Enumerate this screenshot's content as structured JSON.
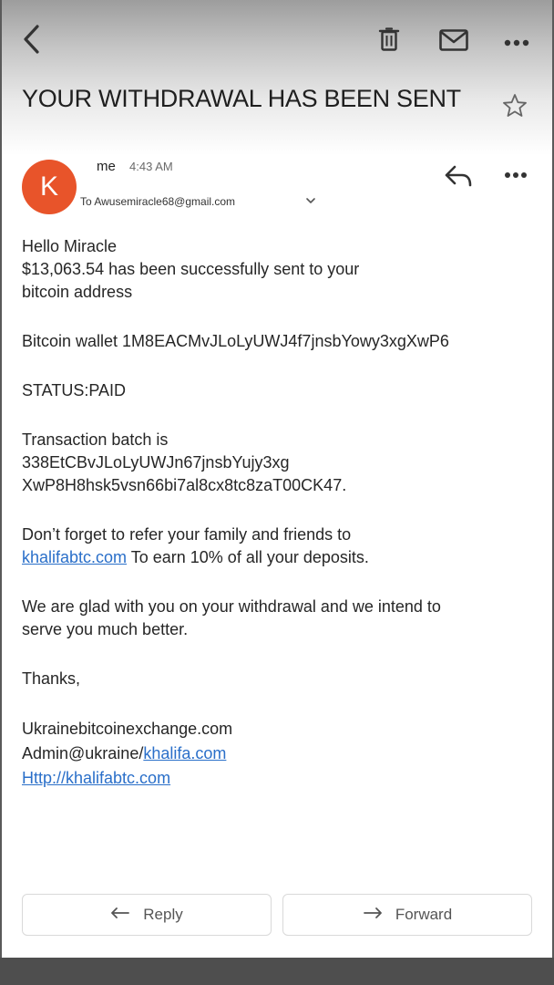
{
  "toolbar": {
    "back_icon": "back-arrow-icon",
    "delete_icon": "trash-icon",
    "mail_icon": "envelope-icon",
    "more_icon": "more-horizontal-icon"
  },
  "email": {
    "subject": "YOUR WITHDRAWAL HAS BEEN SENT",
    "sender_initial": "K",
    "sender_name": "me",
    "time": "4:43 AM",
    "recipient": "To Awusemiracle68@gmail.com",
    "avatar_color": "#e8542a",
    "body": {
      "greeting": "Hello Miracle",
      "amount_line1": "$13,063.54 has been successfully sent to your",
      "amount_line2": "bitcoin address",
      "wallet": "Bitcoin wallet 1M8EACMvJLoLyUWJ4f7jnsbYowy3xgXwP6",
      "status": "STATUS:PAID",
      "batch_label": "Transaction batch is",
      "batch_line1": "338EtCBvJLoLyUWJn67jnsbYujy3xg",
      "batch_line2": "XwP8H8hsk5vsn66bi7al8cx8tc8zaT00CK47.",
      "refer_line1": "Don’t forget to refer your family and friends to",
      "refer_link": "khalifabtc.com",
      "refer_rest": " To earn 10% of all your deposits.",
      "glad_line1": "We are glad with you on your withdrawal and we intend to",
      "glad_line2": "serve you much better.",
      "thanks": "Thanks,",
      "sig_site": "Ukrainebitcoinexchange.com",
      "sig_admin_prefix": "Admin@ukraine/",
      "sig_admin_link": "khalifa.com",
      "sig_url": "Http://khalifabtc.com"
    }
  },
  "actions": {
    "reply_label": "Reply",
    "forward_label": "Forward"
  },
  "colors": {
    "link": "#2a6fc9",
    "avatar": "#e8542a"
  }
}
